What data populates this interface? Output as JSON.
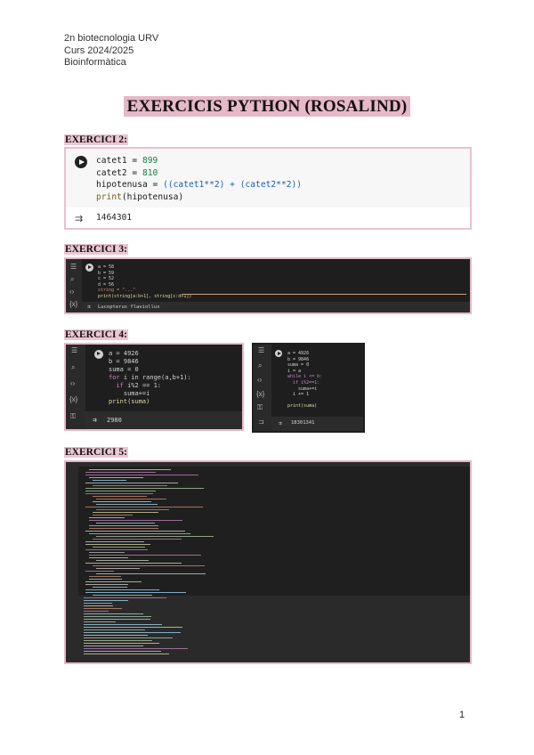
{
  "header": {
    "line1": "2n biotecnologia URV",
    "line2": "Curs 2024/2025",
    "line3": "Bioinformàtica"
  },
  "title": "EXERCICIS PYTHON (ROSALIND)",
  "sections": {
    "ex2": "EXERCICI 2:",
    "ex3": "EXERCICI 3:",
    "ex4": "EXERCICI 4:",
    "ex5": "EXERCICI 5:"
  },
  "ex2_cell": {
    "line1_var": "catet1 = ",
    "line1_val": "899",
    "line2_var": "catet2 = ",
    "line2_val": "810",
    "line3_a": "hipotenusa = ",
    "line3_b": "((catet1**2) + (catet2**2))",
    "line4_fn": "print",
    "line4_arg": "(hipotenusa)",
    "output": "1464301"
  },
  "ex3_cell": {
    "l1": "a = 58",
    "l2": "b = 59",
    "l3": "c = 52",
    "l4": "d = 56",
    "l5": "string = \"...\"",
    "l6": "print(string[a:b+1], string[c:d+1])",
    "output": "Lucopterus flaviollus"
  },
  "ex4_cell_a": {
    "l1": "a = 4926",
    "l2": "b = 9846",
    "l3": "suma = 0",
    "l4_kw": "for",
    "l4_rest": " i in range(a,b+1):",
    "l5_kw": "if",
    "l5_rest": " i%2 == 1:",
    "l6": "suma+=i",
    "l7": "print(suma)",
    "output": "2980"
  },
  "ex4_cell_b": {
    "l1": "a = 4926",
    "l2": "b = 9846",
    "l3": "suma = 0",
    "l4": "i = a",
    "l5": "while i <= b:",
    "l6": "if i%2==1:",
    "l7": "suma+=i",
    "l8": "i += 1",
    "l9": "print(suma)",
    "output": "18301341"
  },
  "page_number": "1",
  "colors": {
    "highlight": "#e6b8c8",
    "dark_bg": "#1e1e1e"
  }
}
